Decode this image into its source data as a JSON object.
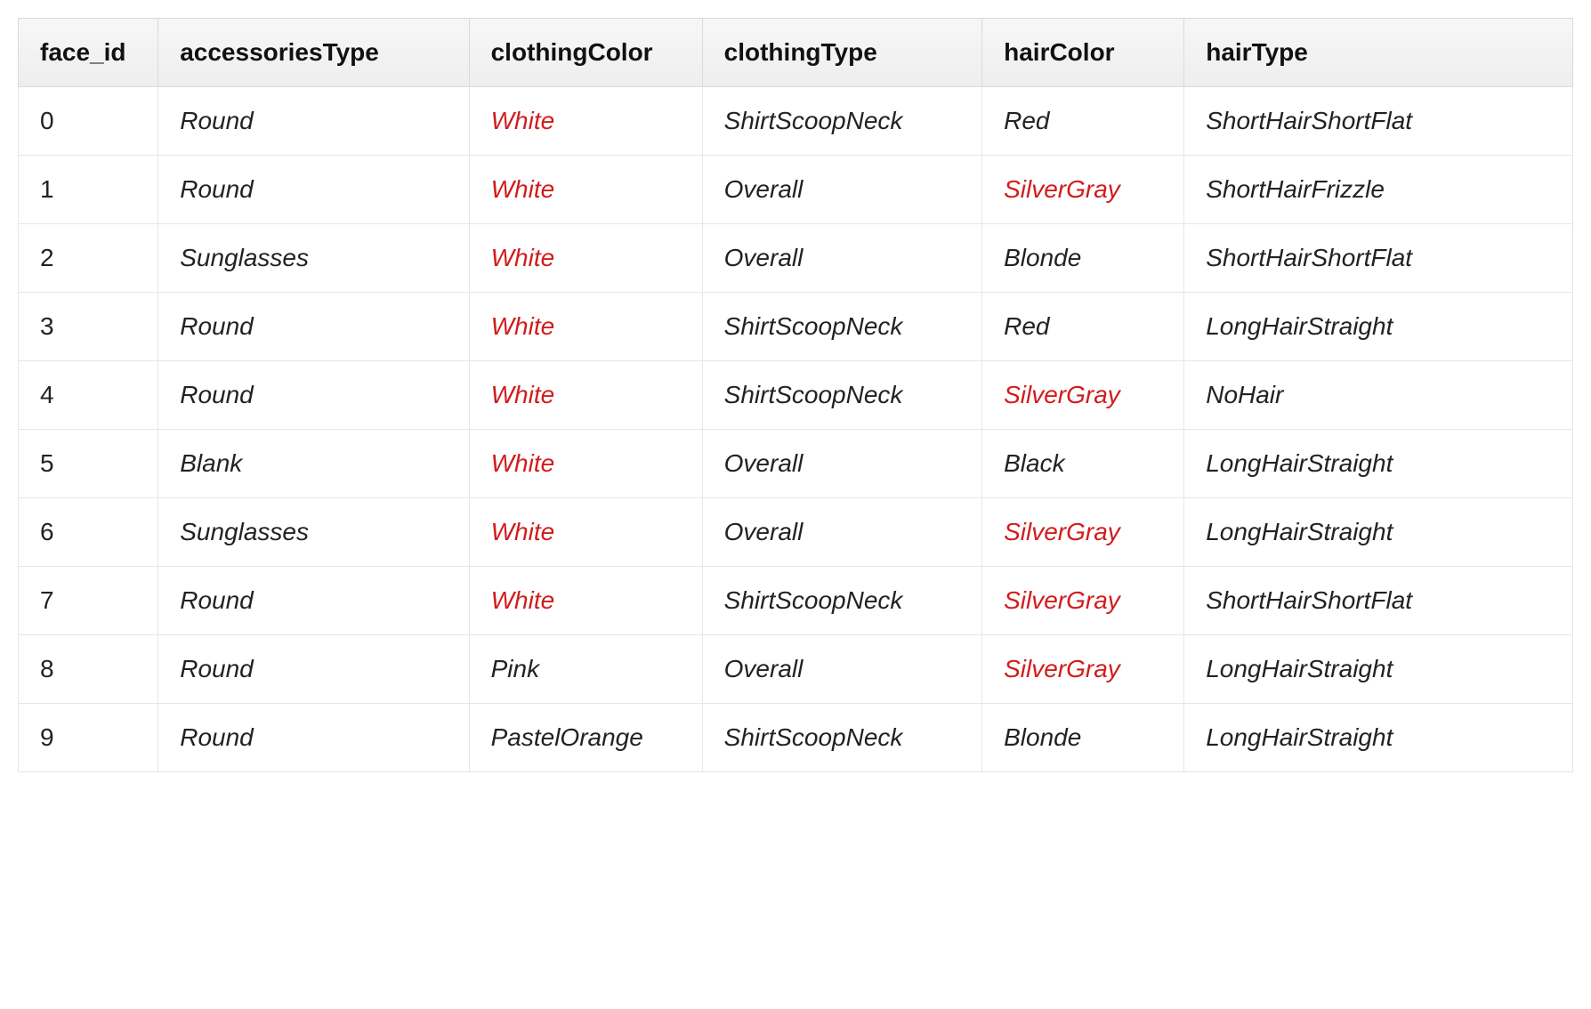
{
  "columns": [
    {
      "key": "face_id",
      "label": "face_id"
    },
    {
      "key": "accessoriesType",
      "label": "accessoriesType"
    },
    {
      "key": "clothingColor",
      "label": "clothingColor"
    },
    {
      "key": "clothingType",
      "label": "clothingType"
    },
    {
      "key": "hairColor",
      "label": "hairColor"
    },
    {
      "key": "hairType",
      "label": "hairType"
    }
  ],
  "rows": [
    {
      "face_id": "0",
      "accessoriesType": "Round",
      "clothingColor": {
        "v": "White",
        "hl": true
      },
      "clothingType": "ShirtScoopNeck",
      "hairColor": {
        "v": "Red"
      },
      "hairType": "ShortHairShortFlat"
    },
    {
      "face_id": "1",
      "accessoriesType": "Round",
      "clothingColor": {
        "v": "White",
        "hl": true
      },
      "clothingType": "Overall",
      "hairColor": {
        "v": "SilverGray",
        "hl": true
      },
      "hairType": "ShortHairFrizzle"
    },
    {
      "face_id": "2",
      "accessoriesType": "Sunglasses",
      "clothingColor": {
        "v": "White",
        "hl": true
      },
      "clothingType": "Overall",
      "hairColor": {
        "v": "Blonde"
      },
      "hairType": "ShortHairShortFlat"
    },
    {
      "face_id": "3",
      "accessoriesType": "Round",
      "clothingColor": {
        "v": "White",
        "hl": true
      },
      "clothingType": "ShirtScoopNeck",
      "hairColor": {
        "v": "Red"
      },
      "hairType": "LongHairStraight"
    },
    {
      "face_id": "4",
      "accessoriesType": "Round",
      "clothingColor": {
        "v": "White",
        "hl": true
      },
      "clothingType": "ShirtScoopNeck",
      "hairColor": {
        "v": "SilverGray",
        "hl": true
      },
      "hairType": "NoHair"
    },
    {
      "face_id": "5",
      "accessoriesType": "Blank",
      "clothingColor": {
        "v": "White",
        "hl": true
      },
      "clothingType": "Overall",
      "hairColor": {
        "v": "Black"
      },
      "hairType": "LongHairStraight"
    },
    {
      "face_id": "6",
      "accessoriesType": "Sunglasses",
      "clothingColor": {
        "v": "White",
        "hl": true
      },
      "clothingType": "Overall",
      "hairColor": {
        "v": "SilverGray",
        "hl": true
      },
      "hairType": "LongHairStraight"
    },
    {
      "face_id": "7",
      "accessoriesType": "Round",
      "clothingColor": {
        "v": "White",
        "hl": true
      },
      "clothingType": "ShirtScoopNeck",
      "hairColor": {
        "v": "SilverGray",
        "hl": true
      },
      "hairType": "ShortHairShortFlat"
    },
    {
      "face_id": "8",
      "accessoriesType": "Round",
      "clothingColor": {
        "v": "Pink"
      },
      "clothingType": "Overall",
      "hairColor": {
        "v": "SilverGray",
        "hl": true
      },
      "hairType": "LongHairStraight"
    },
    {
      "face_id": "9",
      "accessoriesType": "Round",
      "clothingColor": {
        "v": "PastelOrange"
      },
      "clothingType": "ShirtScoopNeck",
      "hairColor": {
        "v": "Blonde"
      },
      "hairType": "LongHairStraight"
    }
  ]
}
